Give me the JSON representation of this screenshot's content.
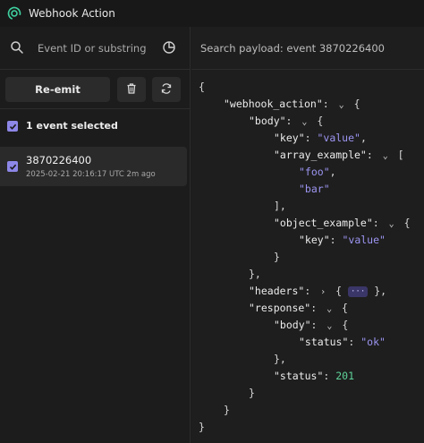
{
  "app": {
    "title": "Webhook Action"
  },
  "sidebar": {
    "search": {
      "placeholder": "Event ID or substring",
      "icon": "search-icon"
    },
    "filter_icon": "pie-chart-icon",
    "actions": {
      "reemit_label": "Re-emit",
      "trash_icon": "trash-icon",
      "refresh_icon": "refresh-icon"
    },
    "selection": {
      "label": "1 event selected",
      "checked": true
    },
    "events": [
      {
        "id": "3870226400",
        "time": "2025-02-21 20:16:17 UTC 2m ago",
        "checked": true
      }
    ]
  },
  "payload": {
    "header": "Search payload: event 3870226400",
    "lines": [
      {
        "indent": 0,
        "text": "{"
      },
      {
        "indent": 1,
        "key": "\"webhook_action\"",
        "chev": "down",
        "open": "{"
      },
      {
        "indent": 2,
        "key": "\"body\"",
        "chev": "down",
        "open": "{"
      },
      {
        "indent": 3,
        "key": "\"key\"",
        "value": "\"value\"",
        "vtype": "string",
        "comma": ","
      },
      {
        "indent": 3,
        "key": "\"array_example\"",
        "chev": "down",
        "open": "["
      },
      {
        "indent": 4,
        "value": "\"foo\"",
        "vtype": "string",
        "comma": ","
      },
      {
        "indent": 4,
        "value": "\"bar\"",
        "vtype": "string"
      },
      {
        "indent": 3,
        "text": "],"
      },
      {
        "indent": 3,
        "key": "\"object_example\"",
        "chev": "down",
        "open": "{"
      },
      {
        "indent": 4,
        "key": "\"key\"",
        "value": "\"value\"",
        "vtype": "string"
      },
      {
        "indent": 3,
        "text": "}"
      },
      {
        "indent": 2,
        "text": "},"
      },
      {
        "indent": 2,
        "key": "\"headers\"",
        "chev": "right",
        "open": "{",
        "collapsed": "···",
        "close": "},"
      },
      {
        "indent": 2,
        "key": "\"response\"",
        "chev": "down",
        "open": "{"
      },
      {
        "indent": 3,
        "key": "\"body\"",
        "chev": "down",
        "open": "{"
      },
      {
        "indent": 4,
        "key": "\"status\"",
        "value": "\"ok\"",
        "vtype": "string"
      },
      {
        "indent": 3,
        "text": "},"
      },
      {
        "indent": 3,
        "key": "\"status\"",
        "value": "201",
        "vtype": "number"
      },
      {
        "indent": 2,
        "text": "}"
      },
      {
        "indent": 1,
        "text": "}"
      },
      {
        "indent": 0,
        "text": "}"
      }
    ]
  },
  "colors": {
    "accent": "#8d87e8",
    "string": "#9c95f2",
    "number": "#5fd39a",
    "background": "#1c1c1c"
  }
}
